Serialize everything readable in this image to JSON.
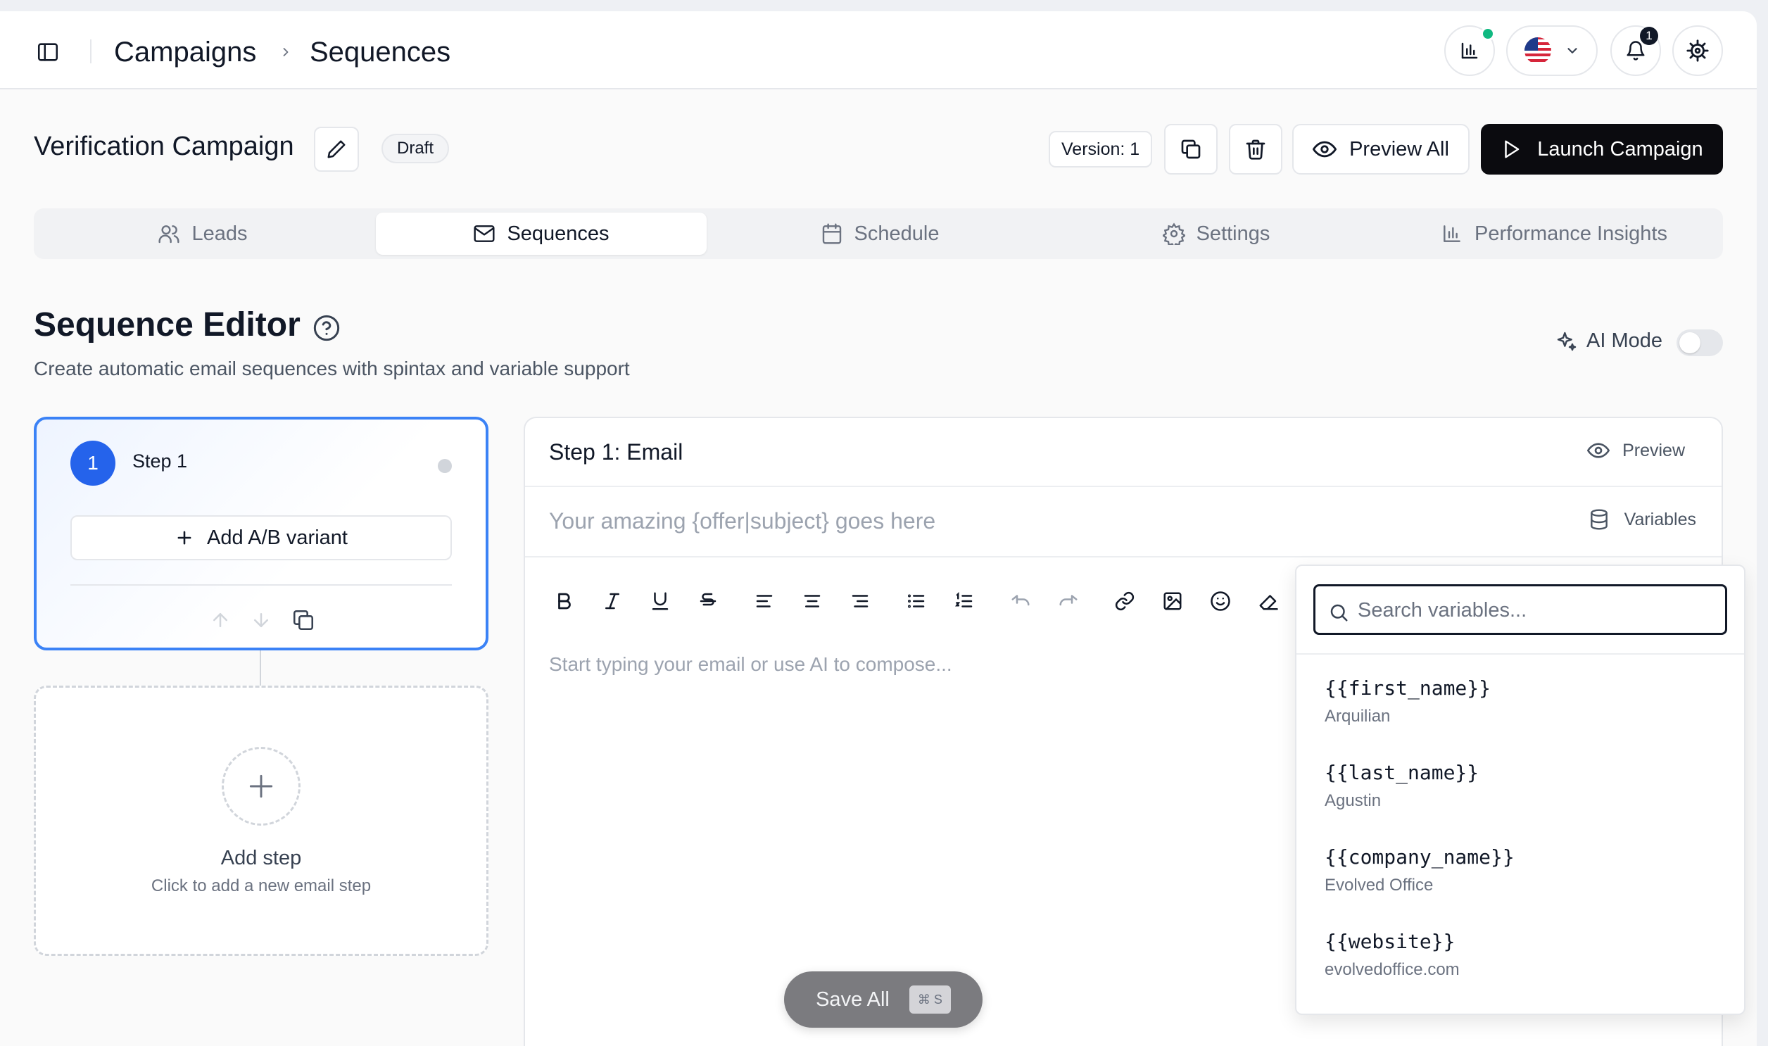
{
  "breadcrumb": {
    "parent": "Campaigns",
    "current": "Sequences"
  },
  "header": {
    "notifications_count": "1"
  },
  "campaign": {
    "title": "Verification Campaign",
    "status": "Draft",
    "version": "Version: 1",
    "preview_all": "Preview All",
    "launch": "Launch Campaign"
  },
  "tabs": [
    {
      "label": "Leads",
      "icon": "users-icon"
    },
    {
      "label": "Sequences",
      "icon": "mail-icon",
      "active": true
    },
    {
      "label": "Schedule",
      "icon": "calendar-icon"
    },
    {
      "label": "Settings",
      "icon": "gear-icon"
    },
    {
      "label": "Performance Insights",
      "icon": "bar-chart-icon"
    }
  ],
  "section": {
    "title": "Sequence Editor",
    "subtitle": "Create automatic email sequences with spintax and variable support",
    "ai_mode_label": "AI Mode",
    "ai_mode_enabled": false
  },
  "steps": [
    {
      "number": "1",
      "label": "Step 1",
      "add_variant": "Add A/B variant"
    }
  ],
  "add_step": {
    "title": "Add step",
    "subtitle": "Click to add a new email step"
  },
  "editor": {
    "title": "Step 1: Email",
    "preview_label": "Preview",
    "subject_placeholder": "Your amazing {offer|subject} goes here",
    "variables_label": "Variables",
    "body_placeholder": "Start typing your email or use AI to compose..."
  },
  "variables_dropdown": {
    "search_placeholder": "Search variables...",
    "items": [
      {
        "key": "{{first_name}}",
        "value": "Arquilian"
      },
      {
        "key": "{{last_name}}",
        "value": "Agustin"
      },
      {
        "key": "{{company_name}}",
        "value": "Evolved Office"
      },
      {
        "key": "{{website}}",
        "value": "evolvedoffice.com"
      }
    ]
  },
  "save_bar": {
    "label": "Save All",
    "shortcut": "⌘ S"
  },
  "colors": {
    "accent": "#2563eb",
    "primary_button": "#0b0b0f",
    "status_online": "#10b981"
  }
}
